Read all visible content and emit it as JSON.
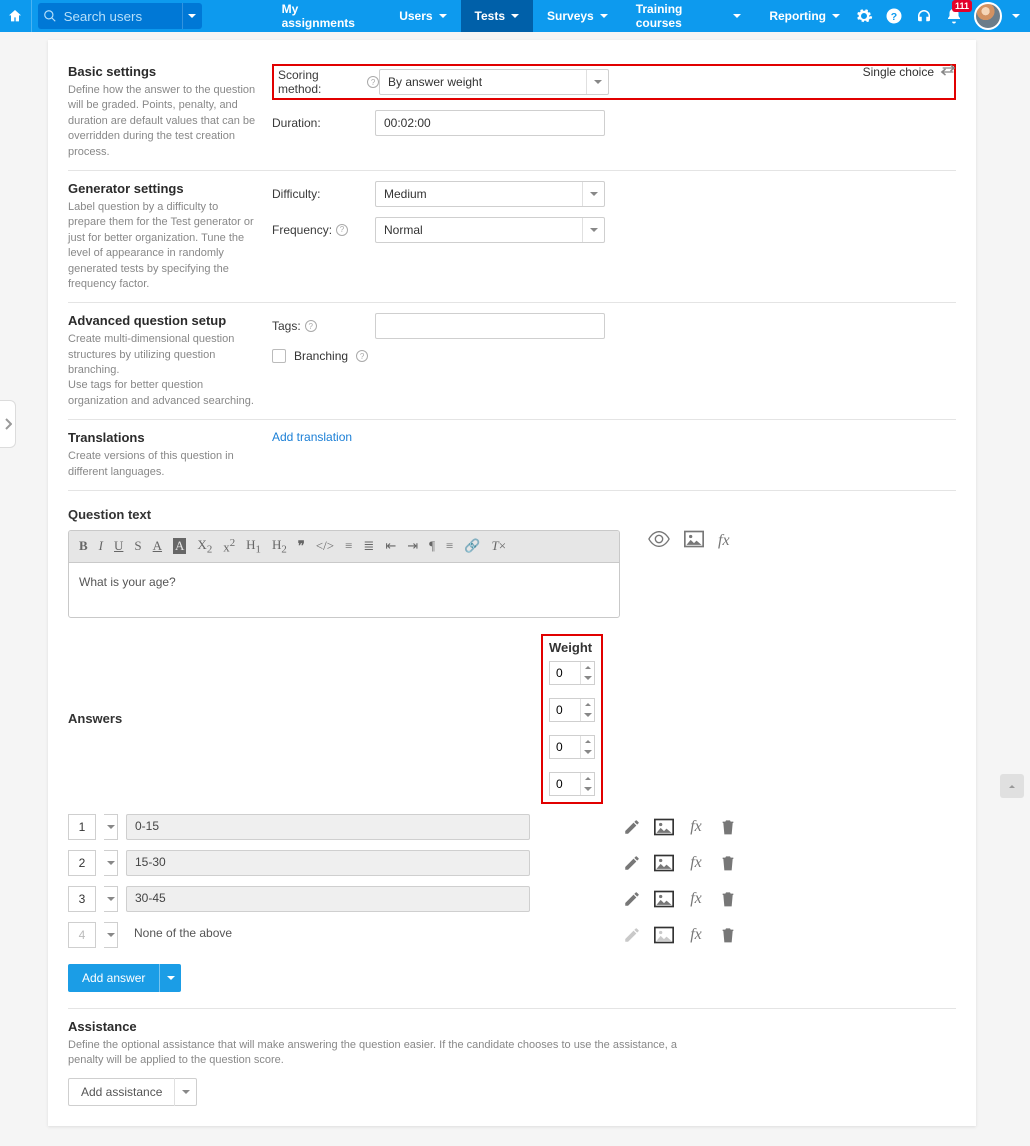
{
  "topbar": {
    "search_placeholder": "Search users",
    "nav": {
      "assignments": "My assignments",
      "users": "Users",
      "tests": "Tests",
      "surveys": "Surveys",
      "training": "Training courses",
      "reporting": "Reporting"
    },
    "notification_count": "111"
  },
  "sections": {
    "basic": {
      "title": "Basic settings",
      "desc": "Define how the answer to the question will be graded. Points, penalty, and duration are default values that can be overridden during the test creation process.",
      "scoring_label": "Scoring method:",
      "scoring_value": "By answer weight",
      "duration_label": "Duration:",
      "duration_value": "00:02:00",
      "right_label": "Single choice"
    },
    "generator": {
      "title": "Generator settings",
      "desc": "Label question by a difficulty to prepare them for the Test generator or just for better organization. Tune the level of appearance in randomly generated tests by specifying the frequency factor.",
      "difficulty_label": "Difficulty:",
      "difficulty_value": "Medium",
      "frequency_label": "Frequency:",
      "frequency_value": "Normal"
    },
    "advanced": {
      "title": "Advanced question setup",
      "desc": "Create multi-dimensional question structures by utilizing question branching.\nUse tags for better question organization and advanced searching.",
      "tags_label": "Tags:",
      "branching_label": "Branching"
    },
    "translations": {
      "title": "Translations",
      "desc": "Create versions of this question in different languages.",
      "link": "Add translation"
    }
  },
  "question": {
    "header": "Question text",
    "text": "What is your age?"
  },
  "answers": {
    "header": "Answers",
    "weight_header": "Weight",
    "rows": [
      {
        "num": "1",
        "text": "0-15",
        "weight": "0",
        "plain": false,
        "disabled": false
      },
      {
        "num": "2",
        "text": "15-30",
        "weight": "0",
        "plain": false,
        "disabled": false
      },
      {
        "num": "3",
        "text": "30-45",
        "weight": "0",
        "plain": false,
        "disabled": false
      },
      {
        "num": "4",
        "text": "None of the above",
        "weight": "0",
        "plain": true,
        "disabled": true
      }
    ],
    "add_button": "Add answer"
  },
  "assistance": {
    "title": "Assistance",
    "desc": "Define the optional assistance that will make answering the question easier. If the candidate chooses to use the assistance, a penalty will be applied to the question score.",
    "button": "Add assistance"
  }
}
